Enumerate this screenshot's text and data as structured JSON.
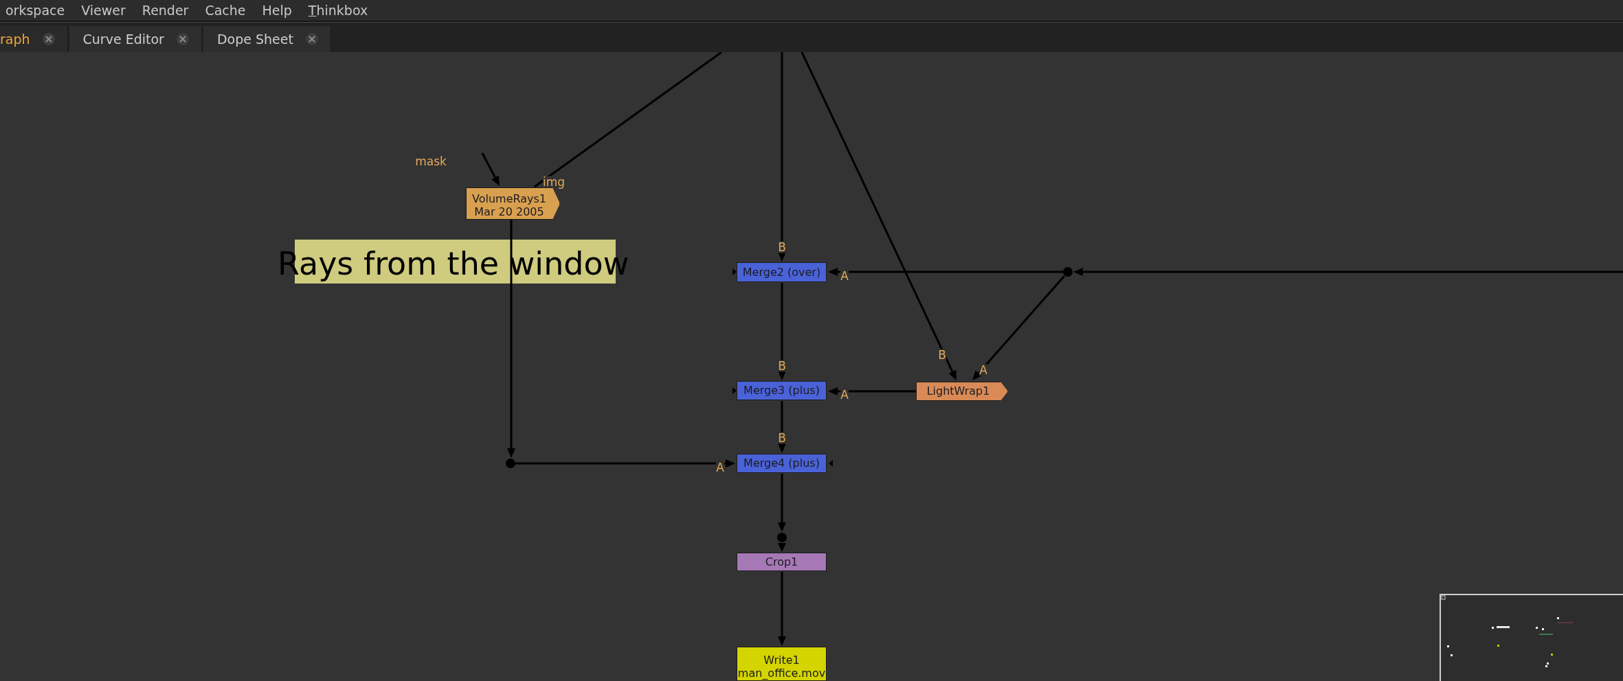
{
  "menu_bar": {
    "items": [
      {
        "label": "orkspace",
        "mnemonic": false
      },
      {
        "label": "Viewer",
        "mnemonic": false
      },
      {
        "label": "Render",
        "mnemonic": false
      },
      {
        "label": "Cache",
        "mnemonic": false
      },
      {
        "label": "Help",
        "mnemonic": false
      },
      {
        "label": "Thinkbox",
        "mnemonic": true
      }
    ]
  },
  "tabs": [
    {
      "label": "raph",
      "selected": true
    },
    {
      "label": "Curve Editor",
      "selected": false
    },
    {
      "label": "Dope Sheet",
      "selected": false
    }
  ],
  "node_graph": {
    "sticky_note": {
      "text": "Rays from the window"
    },
    "nodes": [
      {
        "kind": "gizmo",
        "label": "VolumeRays1",
        "sublabel": "Mar 20 2005",
        "color": "#d9a04f",
        "inputs": [
          "mask",
          "img"
        ]
      },
      {
        "kind": "standard",
        "label": "Merge2 (over)",
        "color": "#4a62d8",
        "inputs": [
          "B",
          "A"
        ]
      },
      {
        "kind": "standard",
        "label": "Merge3 (plus)",
        "color": "#4a62d8",
        "inputs": [
          "B",
          "A"
        ]
      },
      {
        "kind": "standard",
        "label": "Merge4 (plus)",
        "color": "#4a62d8",
        "inputs": [
          "B",
          "A"
        ]
      },
      {
        "kind": "gizmo",
        "label": "LightWrap1",
        "color": "#d98a56",
        "inputs": [
          "B",
          "A"
        ]
      },
      {
        "kind": "standard",
        "label": "Crop1",
        "color": "#a679b6"
      },
      {
        "kind": "standard",
        "label": "Write1",
        "sublabel": "man_office.mov",
        "color": "#d4d400"
      }
    ]
  }
}
